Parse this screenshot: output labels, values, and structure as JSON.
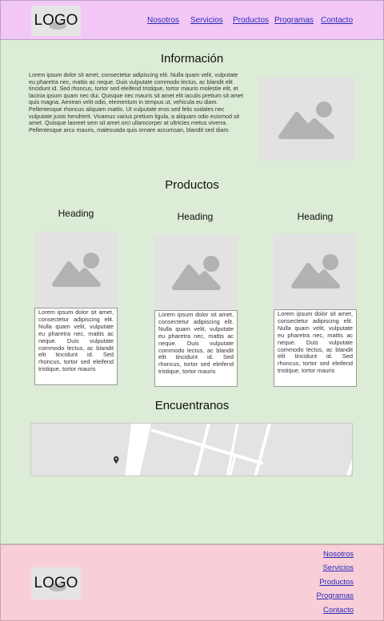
{
  "header": {
    "logo": "LOGO",
    "nav": [
      "Nosotros",
      "Servicios",
      "Productos",
      "Programas",
      "Contacto"
    ]
  },
  "info": {
    "title": "Información",
    "text": "Lorem ipsum dolor sit amet, consectetur adipiscing elit. Nulla quam velit, vulputate eu pharetra nec, mattis ac neque. Duis vulputate commodo lectus, ac blandit elit tincidunt id. Sed rhoncus, tortor sed eleifend tristique, tortor mauris molestie elit, et lacinia ipsum quam nec dui. Quisque nec mauris sit amet elit iaculis pretium sit amet quis magna. Aenean velit odio, elementum in tempus ut, vehicula eu diam. Pellentesque rhoncus aliquam mattis. Ut vulputate eros sed felis sodales nec vulputate justo hendrerit. Vivamus varius pretium ligula, a aliquam odio euismod sit amet. Quisque laoreet sem sit amet orci ullamcorper at ultricies metus viverra. Pellentesque arcu mauris, malesuada quis ornare accumsan, blandit sed diam."
  },
  "products": {
    "title": "Productos",
    "cards": [
      {
        "heading": "Heading",
        "text": "Lorem ipsum dolor sit amet, consectetur adipiscing elit. Nulla quam velit, vulputate eu pharetra nec, mattis ac neque. Duis vulputate commodo lectus, ac blandit elit tincidunt id. Sed rhoncus, tortor sed eleifend tristique, tortor mauris"
      },
      {
        "heading": "Heading",
        "text": "Lorem ipsum dolor sit amet, consectetur adipiscing elit. Nulla quam velit, vulputate eu pharetra nec, mattis ac neque. Duis vulputate commodo lectus, ac blandit elit tincidunt id. Sed rhoncus, tortor sed eleifend tristique, tortor mauris"
      },
      {
        "heading": "Heading",
        "text": "Lorem ipsum dolor sit amet, consectetur adipiscing elit. Nulla quam velit, vulputate eu pharetra nec, mattis ac neque. Duis vulputate commodo lectus, ac blandit elit tincidunt id. Sed rhoncus, tortor sed eleifend tristique, tortor mauris"
      }
    ]
  },
  "location": {
    "title": "Encuentranos"
  },
  "footer": {
    "logo": "LOGO",
    "nav": [
      "Nosotros",
      "Servicios",
      "Productos",
      "Programas",
      "Contacto"
    ]
  },
  "colors": {
    "header_bg": "#f3c8f6",
    "main_bg": "#dcecd6",
    "footer_bg": "#f8cfd8",
    "link": "#2a2ab8",
    "placeholder": "#e2e2e2"
  }
}
